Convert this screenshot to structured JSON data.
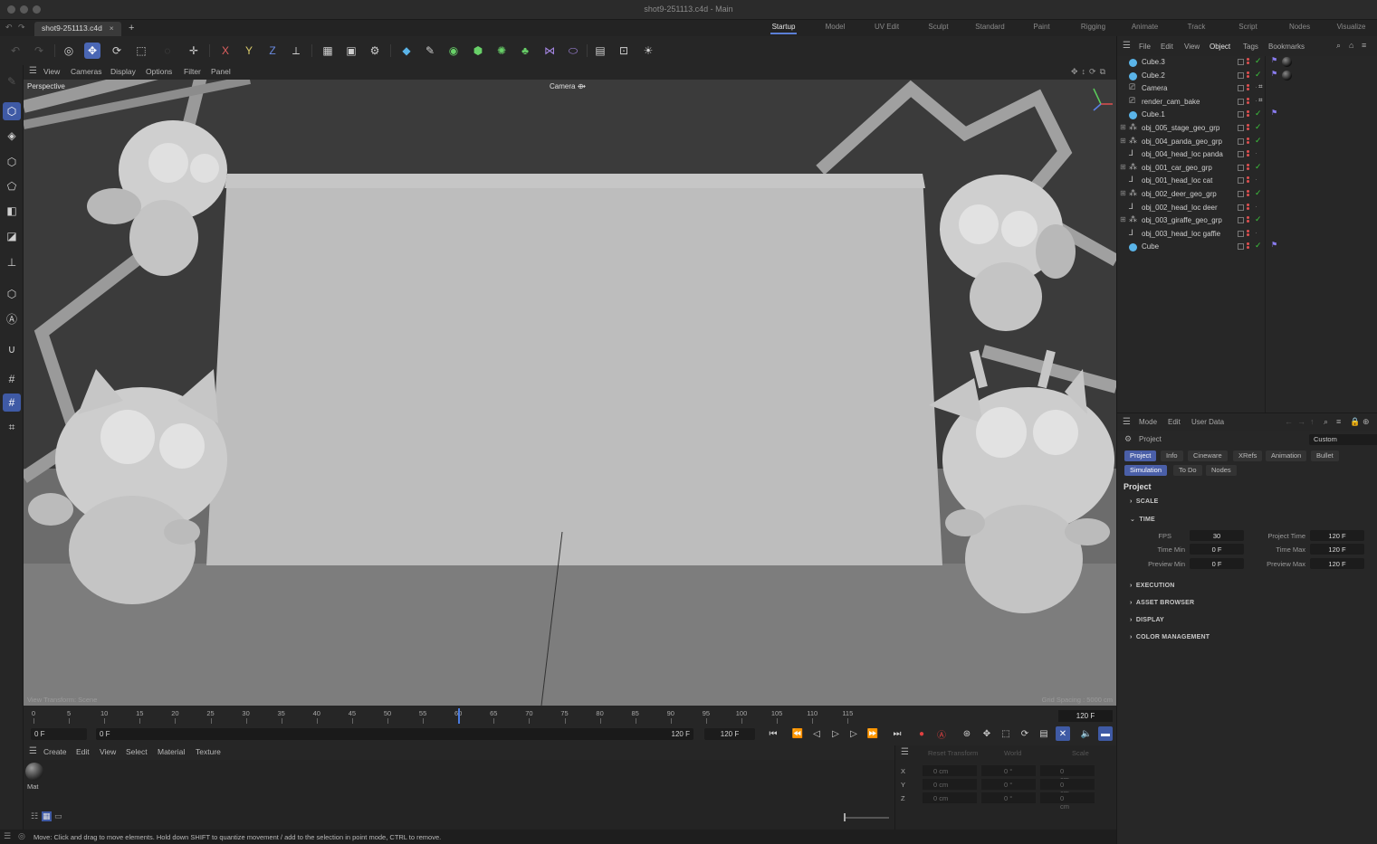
{
  "window": {
    "title": "shot9-251113.c4d - Main"
  },
  "tabs": {
    "document": "shot9-251113.c4d",
    "close": "×",
    "new": "+"
  },
  "layouts": [
    {
      "label": "Startup",
      "active": true
    },
    {
      "label": "Model"
    },
    {
      "label": "UV Edit"
    },
    {
      "label": "Sculpt"
    },
    {
      "label": "Standard"
    },
    {
      "label": "Paint"
    },
    {
      "label": "Rigging"
    },
    {
      "label": "Animate"
    },
    {
      "label": "Track"
    },
    {
      "label": "Script"
    },
    {
      "label": "Nodes"
    },
    {
      "label": "Visualize"
    }
  ],
  "toolbar": {
    "axis_x": "X",
    "axis_y": "Y",
    "axis_z": "Z"
  },
  "viewport": {
    "menu": [
      "View",
      "Cameras",
      "Display",
      "Options",
      "Filter",
      "Panel"
    ],
    "label_perspective": "Perspective",
    "label_camera": "Camera",
    "view_transform": "View Transform: Scene",
    "grid_spacing": "Grid Spacing : 5000 cm"
  },
  "timeline": {
    "ticks": [
      "0",
      "5",
      "10",
      "15",
      "20",
      "25",
      "30",
      "35",
      "40",
      "45",
      "50",
      "55",
      "60",
      "65",
      "70",
      "75",
      "80",
      "85",
      "90",
      "95",
      "100",
      "105",
      "110",
      "115"
    ],
    "current_frame_max": "120 F",
    "start_field": "0 F",
    "start_field2": "0 F",
    "end_field": "120 F",
    "end_field2": "120 F",
    "playhead_frame": 60
  },
  "material_manager": {
    "menu": [
      "Create",
      "Edit",
      "View",
      "Select",
      "Material",
      "Texture"
    ],
    "materials": [
      {
        "name": "Mat"
      }
    ]
  },
  "coordinates": {
    "header": [
      "Reset Transform",
      "World",
      "Scale"
    ],
    "rows": [
      {
        "axis": "X",
        "pos": "0 cm",
        "rot": "0 °",
        "size": "0 cm"
      },
      {
        "axis": "Y",
        "pos": "0 cm",
        "rot": "0 °",
        "size": "0 cm"
      },
      {
        "axis": "Z",
        "pos": "0 cm",
        "rot": "0 °",
        "size": "0 cm"
      }
    ]
  },
  "status": "Move: Click and drag to move elements. Hold down SHIFT to quantize movement / add to the selection in point mode, CTRL to remove.",
  "object_manager": {
    "menu": [
      "File",
      "Edit",
      "View",
      "Object",
      "Tags",
      "Bookmarks"
    ],
    "objects": [
      {
        "name": "Cube.3",
        "type": "cube",
        "check": true,
        "tag": "flag"
      },
      {
        "name": "Cube.2",
        "type": "cube",
        "check": true,
        "tag": "flag"
      },
      {
        "name": "Camera",
        "type": "camera",
        "check": false
      },
      {
        "name": "render_cam_bake",
        "type": "camera",
        "check": false
      },
      {
        "name": "Cube.1",
        "type": "cube",
        "check": true,
        "tag": "flag"
      },
      {
        "name": "obj_005_stage_geo_grp",
        "type": "group",
        "expand": true,
        "check": true
      },
      {
        "name": "obj_004_panda_geo_grp",
        "type": "group",
        "expand": true,
        "check": true
      },
      {
        "name": "obj_004_head_loc panda",
        "type": "null",
        "check": false
      },
      {
        "name": "obj_001_car_geo_grp",
        "type": "group",
        "expand": true,
        "check": true
      },
      {
        "name": "obj_001_head_loc cat",
        "type": "null",
        "check": false
      },
      {
        "name": "obj_002_deer_geo_grp",
        "type": "group",
        "expand": true,
        "check": true
      },
      {
        "name": "obj_002_head_loc deer",
        "type": "null",
        "check": false
      },
      {
        "name": "obj_003_giraffe_geo_grp",
        "type": "group",
        "expand": true,
        "check": true
      },
      {
        "name": "obj_003_head_loc gaffie",
        "type": "null",
        "check": false
      },
      {
        "name": "Cube",
        "type": "cube",
        "check": true,
        "tag": "flag"
      }
    ]
  },
  "attributes": {
    "menu": [
      "Mode",
      "Edit",
      "User Data"
    ],
    "title": "Project",
    "preset": "Custom",
    "tabs_row1": [
      "Project",
      "Info",
      "Cineware",
      "XRefs",
      "Animation",
      "Bullet"
    ],
    "tabs_row2": [
      "Simulation",
      "To Do",
      "Nodes"
    ],
    "heading": "Project",
    "sections": {
      "scale": "SCALE",
      "time": "TIME",
      "execution": "EXECUTION",
      "asset_browser": "ASSET BROWSER",
      "display": "DISPLAY",
      "color_management": "COLOR MANAGEMENT"
    },
    "time": {
      "fps_label": "FPS",
      "fps": "30",
      "project_time_label": "Project Time",
      "project_time": "120 F",
      "time_min_label": "Time Min",
      "time_min": "0 F",
      "time_max_label": "Time Max",
      "time_max": "120 F",
      "preview_min_label": "Preview Min",
      "preview_min": "0 F",
      "preview_max_label": "Preview Max",
      "preview_max": "120 F"
    }
  },
  "colors": {
    "accent": "#4a67b5",
    "check": "#3cc63c",
    "viewport_bg": "#3a3a3a"
  }
}
